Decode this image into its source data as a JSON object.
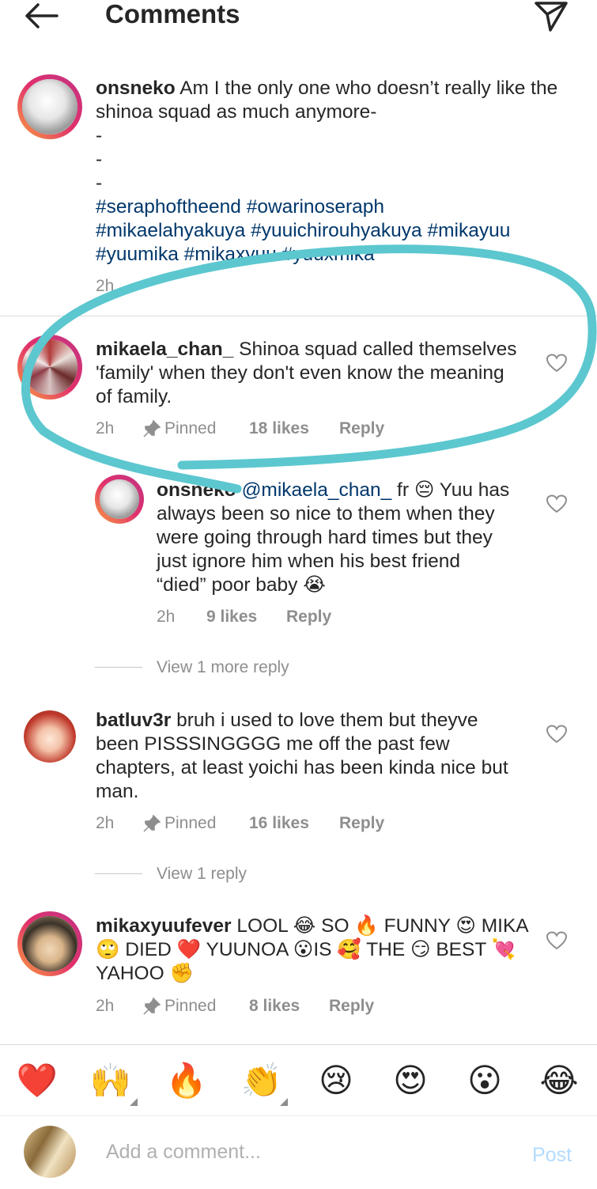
{
  "header": {
    "title": "Comments"
  },
  "caption": {
    "username": "onsneko",
    "text": "Am I the only one who doesn’t really like the shinoa squad as much anymore-",
    "dash_lines": [
      "-",
      "-",
      "-"
    ],
    "hashtags_line1": "#seraphoftheend #owarinoseraph",
    "hashtags_line2": "#mikaelahyakuya #yuuichirouhyakuya #mikayuu",
    "hashtags_line3": "#yuumika #mikaxyuu #yuuxmika",
    "time": "2h"
  },
  "comments": [
    {
      "username": "mikaela_chan_",
      "text_lines": [
        "Shinoa squad called themselves",
        "'family' when they don't even know the meaning",
        "of family."
      ],
      "time": "2h",
      "pinned": "Pinned",
      "likes": "18 likes",
      "reply": "Reply"
    },
    {
      "username": "onsneko",
      "mention": "@mikaela_chan_",
      "text_lines": [
        "fr 😔 Yuu has",
        "always been so nice to them when they",
        "were going through hard times but they",
        "just ignore him when his best friend",
        "“died” poor baby 😭"
      ],
      "time": "2h",
      "likes": "9 likes",
      "reply": "Reply"
    },
    {
      "username": "batluv3r",
      "text_lines": [
        "bruh i used to love them but theyve",
        "been PISSSINGGGG me off the past few",
        "chapters, at least yoichi has been kinda nice but",
        "man."
      ],
      "time": "2h",
      "pinned": "Pinned",
      "likes": "16 likes",
      "reply": "Reply"
    },
    {
      "username": "mikaxyuufever",
      "text_lines": [
        "LOOL 😂 SO 🔥 FUNNY 😍 MIKA",
        "🙄 DIED ❤️ YUUNOA 😮IS 🥰 THE 😏 BEST 💘",
        "YAHOO ✊"
      ],
      "time": "2h",
      "pinned": "Pinned",
      "likes": "8 likes",
      "reply": "Reply"
    }
  ],
  "view_replies": [
    "View 1 more reply",
    "View 1 reply"
  ],
  "emoji_bar": [
    "❤️",
    "🙌",
    "🔥",
    "👏",
    "😢",
    "😍",
    "😮",
    "😂"
  ],
  "input": {
    "placeholder": "Add a comment...",
    "post": "Post"
  },
  "colors": {
    "annotation": "#5cc7cf",
    "link": "#00376b",
    "meta": "#8e8e8e",
    "post": "#b3dbff"
  }
}
